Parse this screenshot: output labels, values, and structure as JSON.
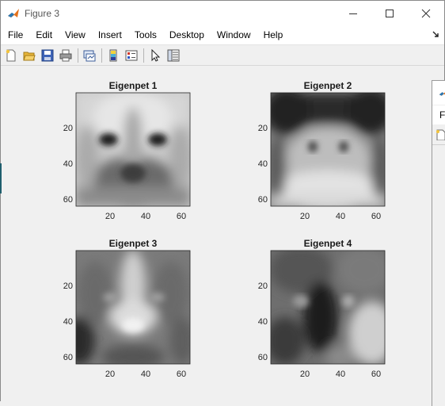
{
  "window": {
    "title": "Figure 3"
  },
  "menu": [
    "File",
    "Edit",
    "View",
    "Insert",
    "Tools",
    "Desktop",
    "Window",
    "Help"
  ],
  "toolbar": {
    "icons": [
      "new-figure-icon",
      "open-file-icon",
      "save-icon",
      "print-icon",
      "link-plot-icon",
      "insert-colorbar-icon",
      "insert-legend-icon",
      "pointer-icon",
      "property-inspector-icon"
    ]
  },
  "background_window": {
    "menu_fragment": "Fi"
  },
  "subplots": [
    {
      "title": "Eigenpet 1",
      "xticks": [
        "20",
        "40",
        "60"
      ],
      "yticks": [
        "20",
        "40",
        "60"
      ]
    },
    {
      "title": "Eigenpet 2",
      "xticks": [
        "20",
        "40",
        "60"
      ],
      "yticks": [
        "20",
        "40",
        "60"
      ]
    },
    {
      "title": "Eigenpet 3",
      "xticks": [
        "20",
        "40",
        "60"
      ],
      "yticks": [
        "20",
        "40",
        "60"
      ]
    },
    {
      "title": "Eigenpet 4",
      "xticks": [
        "20",
        "40",
        "60"
      ],
      "yticks": [
        "20",
        "40",
        "60"
      ]
    }
  ],
  "colors": {
    "accent_matlab": "#e5721c",
    "titlebar": "#ffffff",
    "figure_bg": "#f0f0f0"
  }
}
